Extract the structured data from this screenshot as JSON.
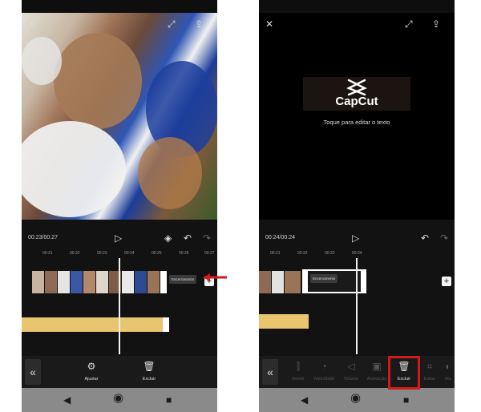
{
  "left_phone": {
    "time": "00:23/00:27",
    "ruler_ticks": [
      "00:21",
      "00:22",
      "00:23",
      "00:24",
      "00:25",
      "00:26",
      "00:27"
    ],
    "ending_label": "Encerramento",
    "tools": [
      {
        "label": "Ajustar",
        "icon": "sliders-icon"
      },
      {
        "label": "Excluir",
        "icon": "trash-icon"
      }
    ]
  },
  "right_phone": {
    "time": "00:24/00:24",
    "logo_text": "CapCut",
    "caption": "Toque para editar o texto",
    "ruler_ticks": [
      "00:21",
      "00:22",
      "00:23",
      "00:24"
    ],
    "ending_label": "Encerramento",
    "tools": [
      {
        "label": "Dividir",
        "icon": "split-icon"
      },
      {
        "label": "Velocidade",
        "icon": "speed-icon"
      },
      {
        "label": "Volume",
        "icon": "volume-icon"
      },
      {
        "label": "Animação",
        "icon": "animation-icon"
      },
      {
        "label": "Excluir",
        "icon": "trash-icon"
      },
      {
        "label": "Editar",
        "icon": "crop-icon"
      },
      {
        "label": "Ma",
        "icon": "more-icon"
      }
    ]
  },
  "colors": {
    "highlight": "#d21a1a",
    "audio_track": "#e9c56f",
    "background": "#121212"
  }
}
